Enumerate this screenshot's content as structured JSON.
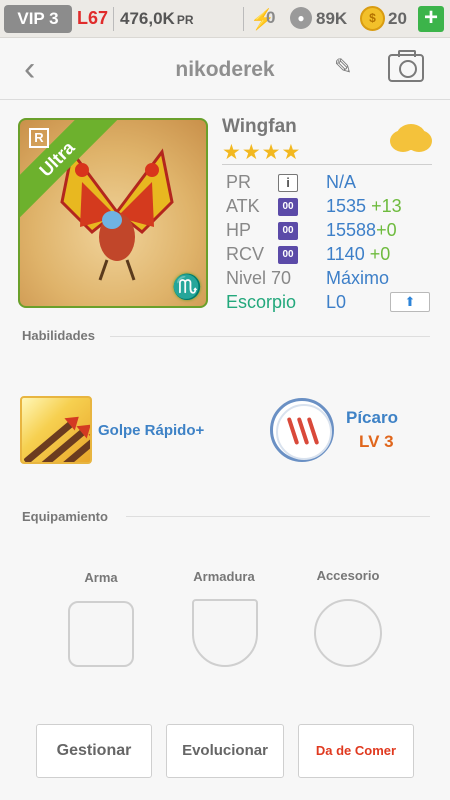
{
  "statusbar": {
    "vip": "VIP 3",
    "level": "L67",
    "power": "476,0K",
    "power_unit": "PR",
    "stamina": "0",
    "friends": "89K",
    "coins": "20",
    "add_label": "+"
  },
  "header": {
    "title": "nikoderek"
  },
  "monster": {
    "name": "Wingfan",
    "rarity": "Ultra",
    "rarity_badge": "R",
    "stars": "★★★★",
    "zodiac_glyph": "♏",
    "stats": [
      {
        "label": "PR",
        "icon": "i",
        "value": "N/A",
        "bonus": ""
      },
      {
        "label": "ATK",
        "icon": "00",
        "value": "1535",
        "bonus": "+13"
      },
      {
        "label": "HP",
        "icon": "00",
        "value": "15588",
        "bonus": "+0"
      },
      {
        "label": "RCV",
        "icon": "00",
        "value": "1140",
        "bonus": "+0"
      }
    ],
    "level_label": "Nivel 70",
    "level_value": "Máximo",
    "sign_label": "Escorpio",
    "sign_value": "L0"
  },
  "skills": {
    "section_title": "Habilidades",
    "active_name": "Golpe Rápido+",
    "trait_name": "Pícaro",
    "trait_level": "LV 3"
  },
  "equipment": {
    "section_title": "Equipamiento",
    "weapon": "Arma",
    "armor": "Armadura",
    "accessory": "Accesorio"
  },
  "actions": {
    "manage": "Gestionar",
    "evolve": "Evolucionar",
    "feed": "Da de Comer"
  }
}
